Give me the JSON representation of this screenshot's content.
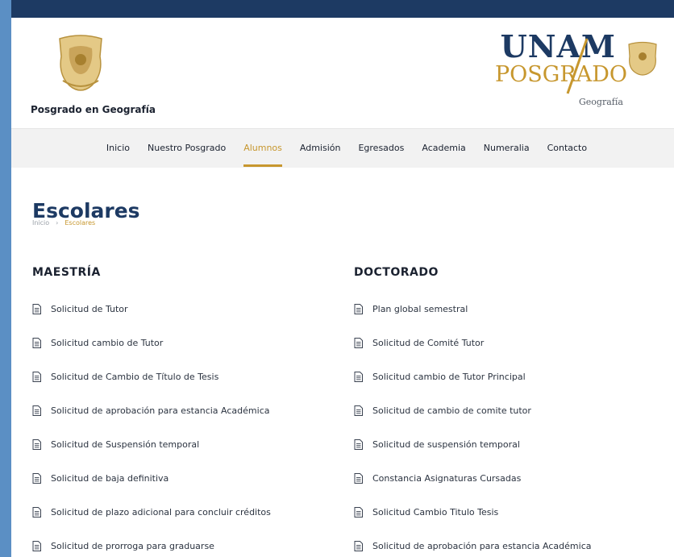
{
  "header": {
    "site_name": "Posgrado en Geografía",
    "brand_top": "UNAM",
    "brand_bottom": "POSGRADO",
    "brand_sub": "Geografía"
  },
  "nav": {
    "items": [
      {
        "label": "Inicio",
        "active": false
      },
      {
        "label": "Nuestro Posgrado",
        "active": false
      },
      {
        "label": "Alumnos",
        "active": true
      },
      {
        "label": "Admisión",
        "active": false
      },
      {
        "label": "Egresados",
        "active": false
      },
      {
        "label": "Academia",
        "active": false
      },
      {
        "label": "Numeralia",
        "active": false
      },
      {
        "label": "Contacto",
        "active": false
      }
    ]
  },
  "page": {
    "title": "Escolares",
    "breadcrumb": {
      "home": "Inicio",
      "separator": "›",
      "current": "Escolares"
    }
  },
  "maestria": {
    "title": "MAESTRÍA",
    "items": [
      "Solicitud de Tutor",
      "Solicitud cambio de Tutor",
      "Solicitud de Cambio de Título de Tesis",
      "Solicitud de aprobación para estancia Académica",
      "Solicitud de Suspensión temporal",
      "Solicitud de baja definitiva",
      "Solicitud de plazo adicional para concluir créditos",
      "Solicitud de prorroga para graduarse"
    ]
  },
  "doctorado": {
    "title": "DOCTORADO",
    "items": [
      "Plan global semestral",
      "Solicitud de Comité Tutor",
      "Solicitud cambio de Tutor Principal",
      "Solicitud de cambio de comite tutor",
      "Solicitud de suspensión temporal",
      "Constancia Asignaturas Cursadas",
      "Solicitud Cambio Titulo Tesis",
      "Solicitud de aprobación para estancia Académica"
    ]
  },
  "colors": {
    "navy": "#1d3a63",
    "gold": "#c7972e",
    "nav_bg": "#f2f2f2",
    "side_bg": "#5b8fc4"
  },
  "icons": {
    "document": "document-icon",
    "crest": "crest-icon"
  }
}
